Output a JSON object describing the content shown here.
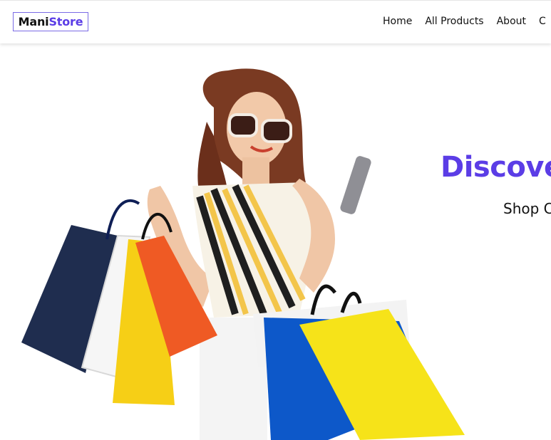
{
  "brand": {
    "name_part1": "Mani",
    "name_part2": "Store",
    "accent_color": "#5b3de6"
  },
  "nav": {
    "items": [
      {
        "label": "Home"
      },
      {
        "label": "All Products"
      },
      {
        "label": "About"
      },
      {
        "label": "C"
      }
    ]
  },
  "hero": {
    "title": "Discove",
    "subtitle": "Shop C",
    "image": "woman-with-shopping-bags"
  }
}
